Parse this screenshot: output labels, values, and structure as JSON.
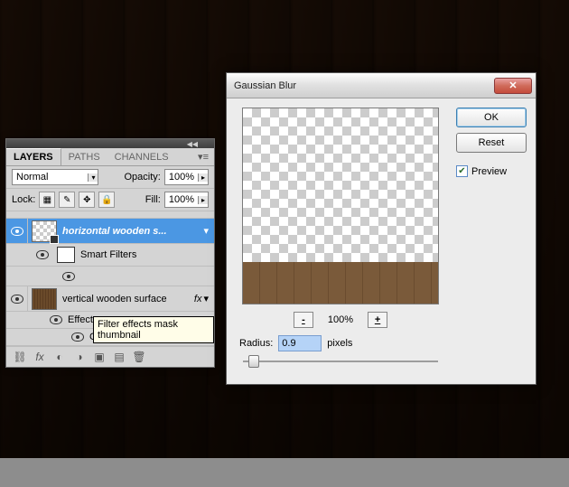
{
  "layers_panel": {
    "tabs": {
      "layers": "LAYERS",
      "paths": "PATHS",
      "channels": "CHANNELS"
    },
    "blend_mode": "Normal",
    "opacity_label": "Opacity:",
    "opacity_value": "100%",
    "lock_label": "Lock:",
    "fill_label": "Fill:",
    "fill_value": "100%",
    "layer1_name": "horizontal wooden s...",
    "smart_filters_label": "Smart Filters",
    "tooltip_text": "Filter effects mask thumbnail",
    "layer2_name": "vertical wooden surface",
    "effects_label": "Effects",
    "gradient_overlay_label": "Gradient Overlay",
    "fx_badge": "fx"
  },
  "dialog": {
    "title": "Gaussian Blur",
    "ok": "OK",
    "reset": "Reset",
    "preview": "Preview",
    "zoom_value": "100%",
    "radius_label": "Radius:",
    "radius_value": "0.9",
    "radius_unit": "pixels"
  }
}
